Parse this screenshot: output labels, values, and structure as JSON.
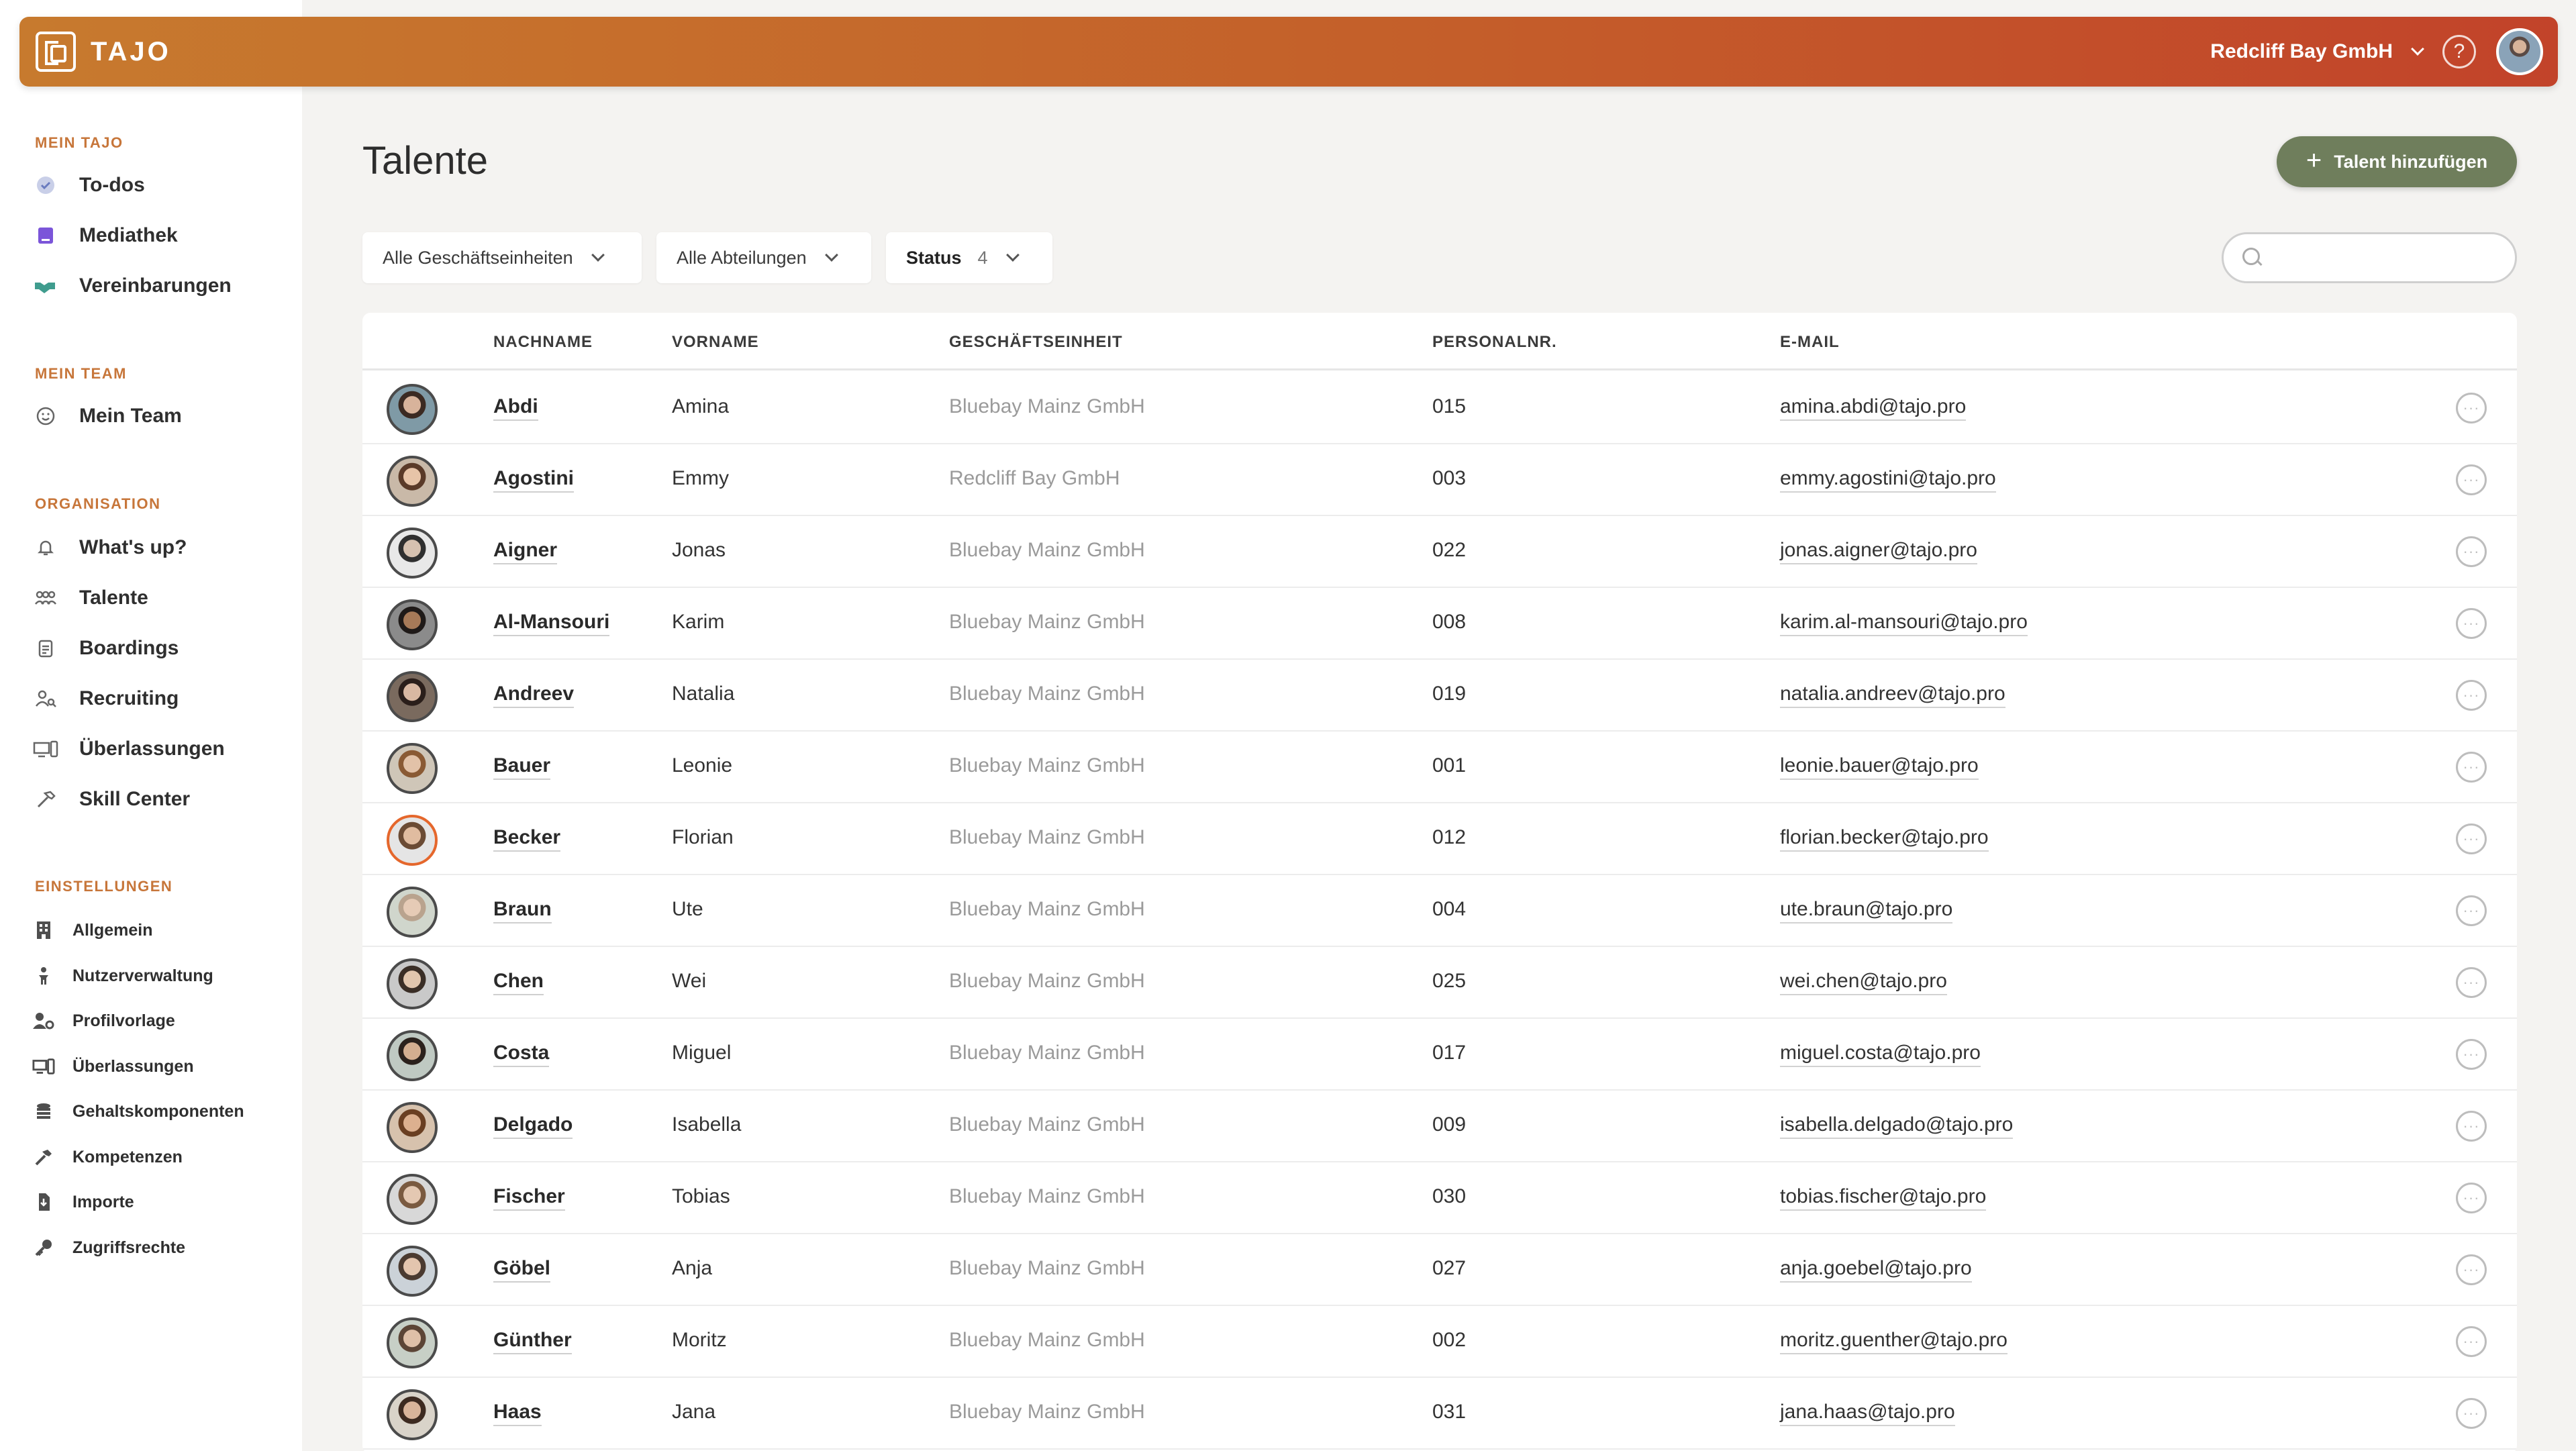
{
  "topbar": {
    "brand": "TAJO",
    "company": "Redcliff Bay GmbH",
    "help_icon": "?"
  },
  "sidebar": {
    "sections": [
      {
        "title": "MEIN TAJO",
        "items": [
          {
            "label": "To-dos",
            "icon": "check-circle-icon"
          },
          {
            "label": "Mediathek",
            "icon": "book-icon"
          },
          {
            "label": "Vereinbarungen",
            "icon": "handshake-icon"
          }
        ]
      },
      {
        "title": "MEIN TEAM",
        "items": [
          {
            "label": "Mein Team",
            "icon": "smiley-icon"
          }
        ]
      },
      {
        "title": "ORGANISATION",
        "items": [
          {
            "label": "What's up?",
            "icon": "bell-icon"
          },
          {
            "label": "Talente",
            "icon": "people-icon"
          },
          {
            "label": "Boardings",
            "icon": "clipboard-icon"
          },
          {
            "label": "Recruiting",
            "icon": "user-search-icon"
          },
          {
            "label": "Überlassungen",
            "icon": "devices-icon"
          },
          {
            "label": "Skill Center",
            "icon": "hammer-icon"
          }
        ]
      },
      {
        "title": "EINSTELLUNGEN",
        "items": [
          {
            "label": "Allgemein",
            "icon": "building-icon"
          },
          {
            "label": "Nutzerverwaltung",
            "icon": "user-admin-icon"
          },
          {
            "label": "Profilvorlage",
            "icon": "user-settings-icon"
          },
          {
            "label": "Überlassungen",
            "icon": "devices-icon"
          },
          {
            "label": "Gehaltskomponenten",
            "icon": "coins-icon"
          },
          {
            "label": "Kompetenzen",
            "icon": "hammer-icon"
          },
          {
            "label": "Importe",
            "icon": "import-icon"
          },
          {
            "label": "Zugriffsrechte",
            "icon": "key-icon"
          }
        ]
      }
    ]
  },
  "main": {
    "title": "Talente",
    "add_button": "Talent hinzufügen",
    "filters": {
      "units": "Alle Geschäftseinheiten",
      "departments": "Alle Abteilungen",
      "status_label": "Status",
      "status_count": "4"
    },
    "search": {
      "placeholder": ""
    },
    "columns": [
      "NACHNAME",
      "VORNAME",
      "GESCHÄFTSEINHEIT",
      "PERSONALNR.",
      "E-MAIL"
    ],
    "rows": [
      {
        "last": "Abdi",
        "first": "Amina",
        "unit": "Bluebay Mainz GmbH",
        "nr": "015",
        "email": "amina.abdi@tajo.pro"
      },
      {
        "last": "Agostini",
        "first": "Emmy",
        "unit": "Redcliff Bay GmbH",
        "nr": "003",
        "email": "emmy.agostini@tajo.pro"
      },
      {
        "last": "Aigner",
        "first": "Jonas",
        "unit": "Bluebay Mainz GmbH",
        "nr": "022",
        "email": "jonas.aigner@tajo.pro"
      },
      {
        "last": "Al-Mansouri",
        "first": "Karim",
        "unit": "Bluebay Mainz GmbH",
        "nr": "008",
        "email": "karim.al-mansouri@tajo.pro"
      },
      {
        "last": "Andreev",
        "first": "Natalia",
        "unit": "Bluebay Mainz GmbH",
        "nr": "019",
        "email": "natalia.andreev@tajo.pro"
      },
      {
        "last": "Bauer",
        "first": "Leonie",
        "unit": "Bluebay Mainz GmbH",
        "nr": "001",
        "email": "leonie.bauer@tajo.pro"
      },
      {
        "last": "Becker",
        "first": "Florian",
        "unit": "Bluebay Mainz GmbH",
        "nr": "012",
        "email": "florian.becker@tajo.pro"
      },
      {
        "last": "Braun",
        "first": "Ute",
        "unit": "Bluebay Mainz GmbH",
        "nr": "004",
        "email": "ute.braun@tajo.pro"
      },
      {
        "last": "Chen",
        "first": "Wei",
        "unit": "Bluebay Mainz GmbH",
        "nr": "025",
        "email": "wei.chen@tajo.pro"
      },
      {
        "last": "Costa",
        "first": "Miguel",
        "unit": "Bluebay Mainz GmbH",
        "nr": "017",
        "email": "miguel.costa@tajo.pro"
      },
      {
        "last": "Delgado",
        "first": "Isabella",
        "unit": "Bluebay Mainz GmbH",
        "nr": "009",
        "email": "isabella.delgado@tajo.pro"
      },
      {
        "last": "Fischer",
        "first": "Tobias",
        "unit": "Bluebay Mainz GmbH",
        "nr": "030",
        "email": "tobias.fischer@tajo.pro"
      },
      {
        "last": "Göbel",
        "first": "Anja",
        "unit": "Bluebay Mainz GmbH",
        "nr": "027",
        "email": "anja.goebel@tajo.pro"
      },
      {
        "last": "Günther",
        "first": "Moritz",
        "unit": "Bluebay Mainz GmbH",
        "nr": "002",
        "email": "moritz.guenther@tajo.pro"
      },
      {
        "last": "Haas",
        "first": "Jana",
        "unit": "Bluebay Mainz GmbH",
        "nr": "031",
        "email": "jana.haas@tajo.pro"
      }
    ]
  },
  "colors": {
    "accent_orange": "#c7763a",
    "primary_button": "#6f7e5c",
    "topbar_start": "#c77a2e",
    "topbar_end": "#c2432a"
  }
}
